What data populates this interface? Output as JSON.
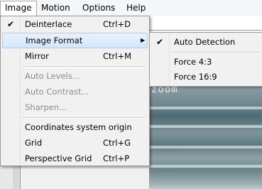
{
  "menubar": {
    "items": [
      {
        "label": "Image",
        "open": true
      },
      {
        "label": "Motion"
      },
      {
        "label": "Options"
      },
      {
        "label": "Help"
      }
    ]
  },
  "image_menu": {
    "items": [
      {
        "label": "Deinterlace",
        "shortcut": "Ctrl+D",
        "checked": true
      },
      {
        "label": "Image Format",
        "submenu": true,
        "highlighted": true
      },
      {
        "label": "Mirror",
        "shortcut": "Ctrl+M"
      },
      {
        "label": "Auto Levels...",
        "disabled": true
      },
      {
        "label": "Auto Contrast...",
        "disabled": true
      },
      {
        "label": "Sharpen...",
        "disabled": true
      },
      {
        "label": "Coordinates system origin"
      },
      {
        "label": "Grid",
        "shortcut": "Ctrl+G"
      },
      {
        "label": "Perspective Grid",
        "shortcut": "Ctrl+P"
      }
    ]
  },
  "image_format_submenu": {
    "items": [
      {
        "label": "Auto Detection",
        "checked": true
      },
      {
        "label": "Force 4:3"
      },
      {
        "label": "Force 16:9"
      }
    ]
  },
  "video": {
    "overlay_text": "zoom"
  },
  "icons": {
    "check": "check-icon",
    "submenu_arrow": "submenu-arrow-icon"
  }
}
